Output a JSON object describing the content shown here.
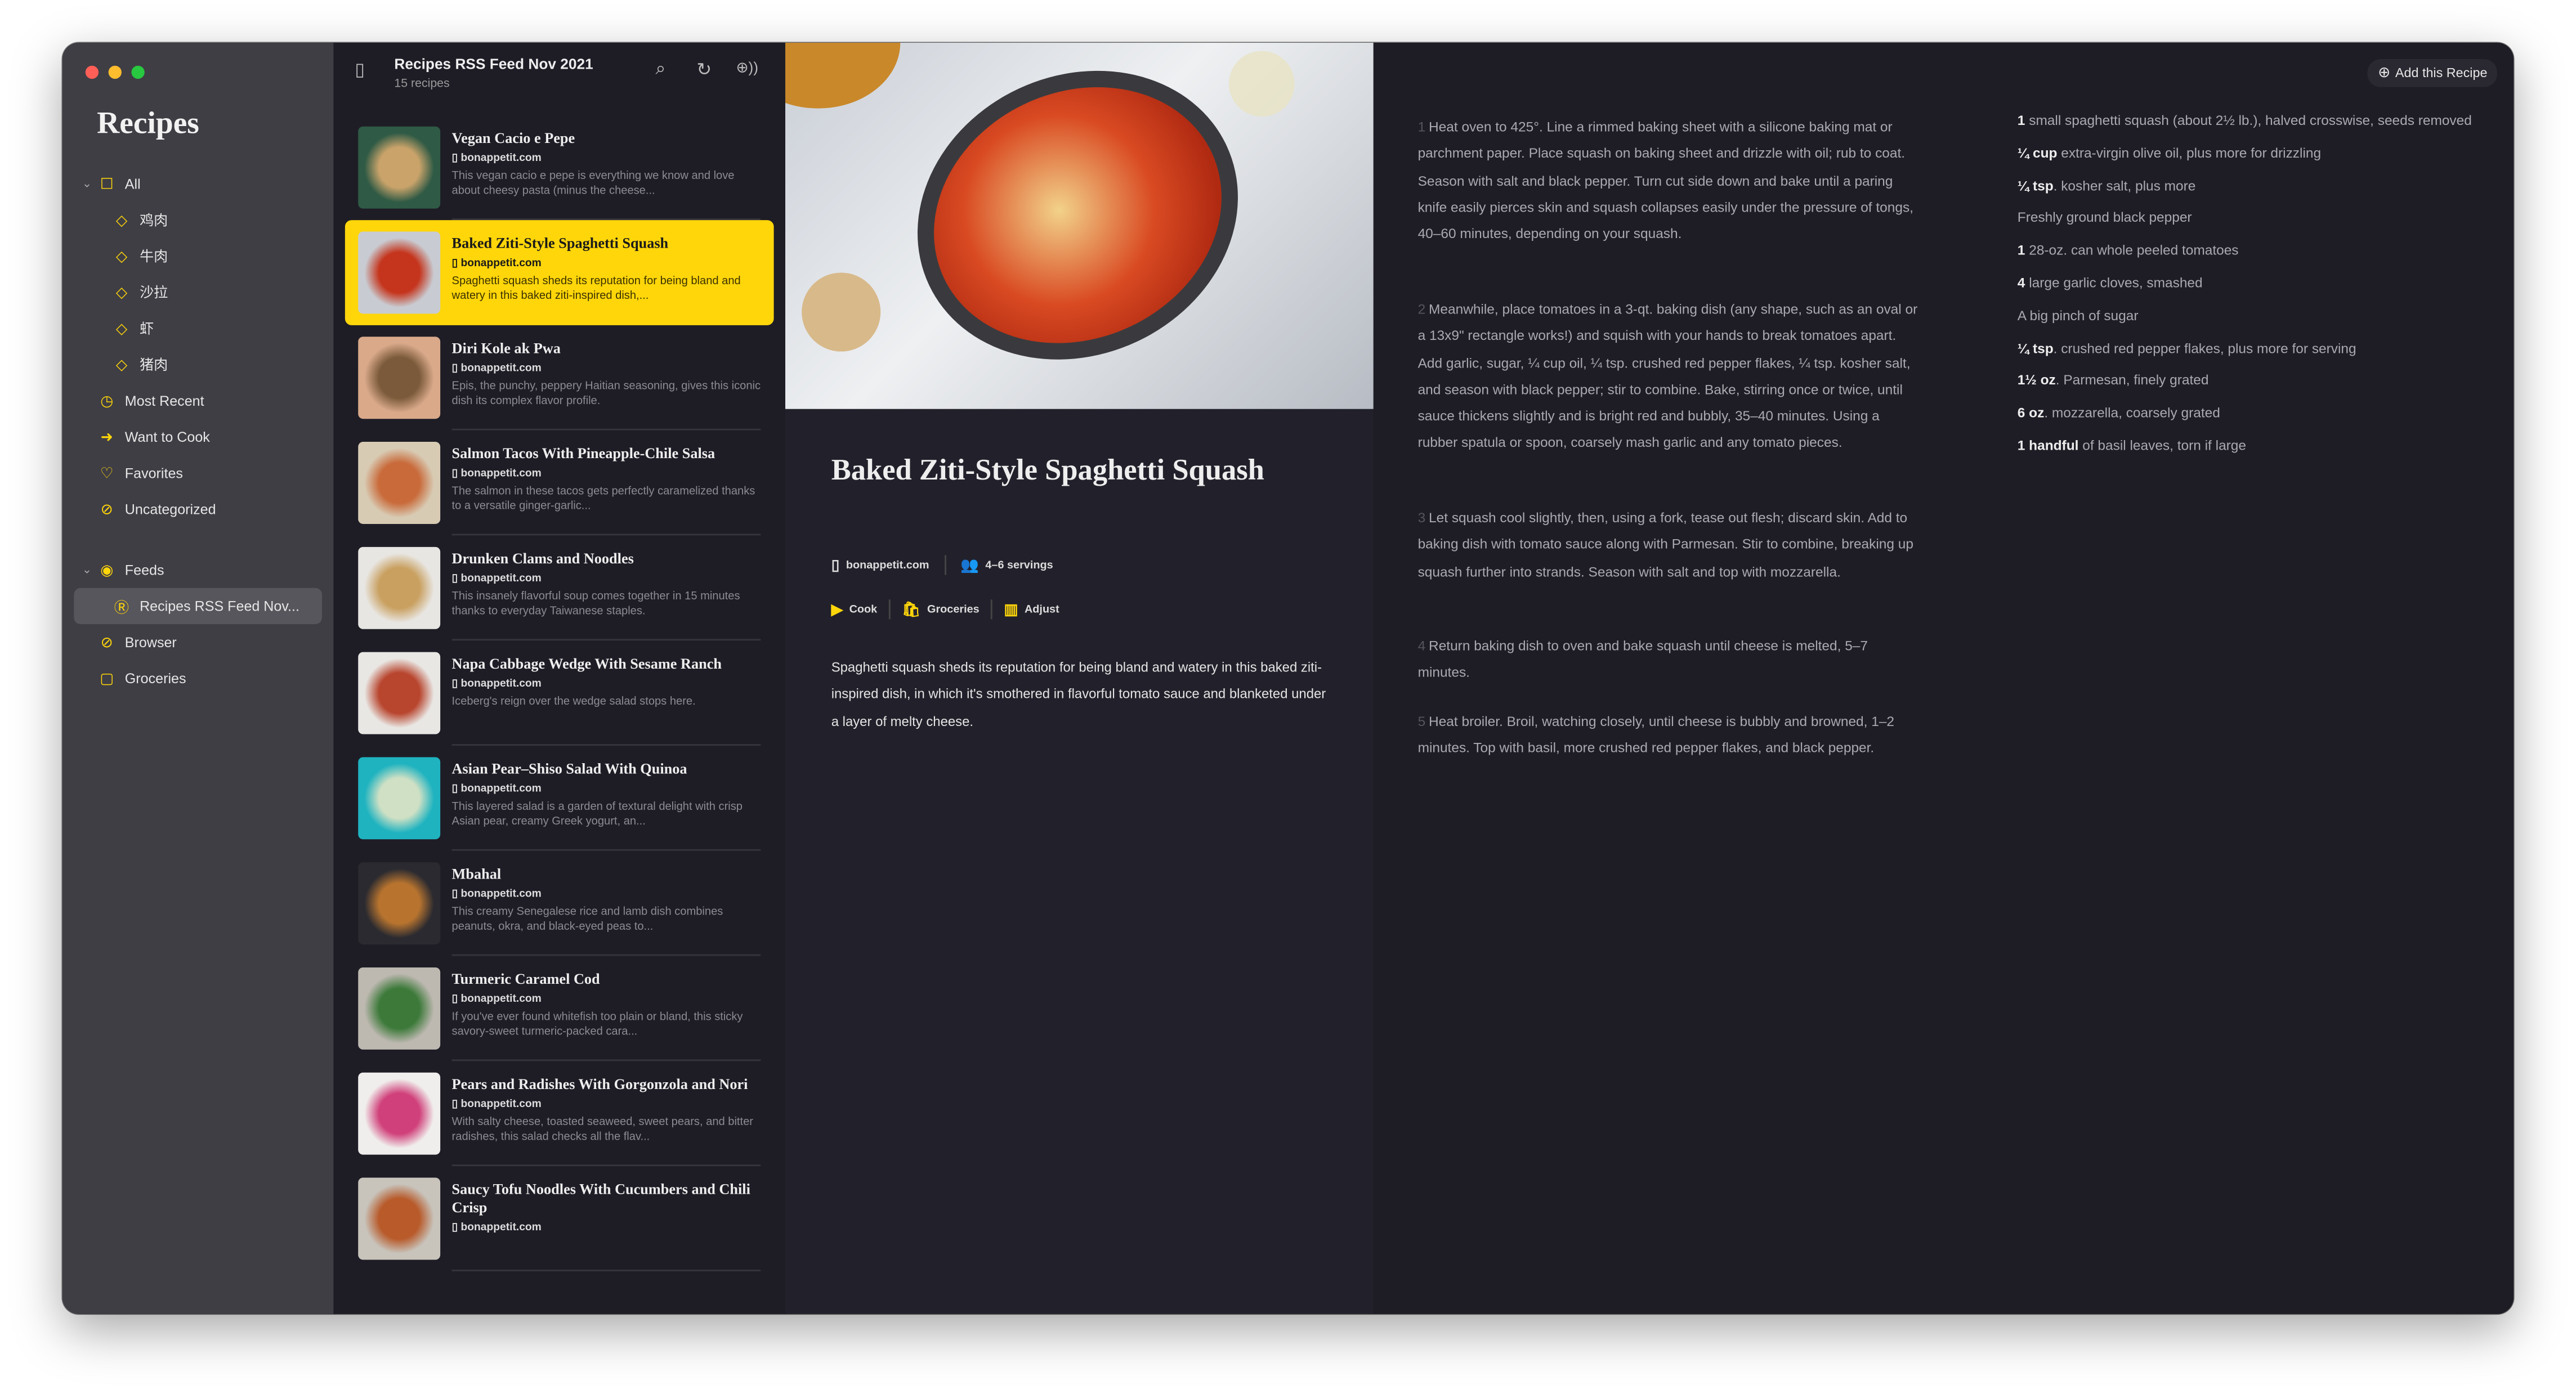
{
  "sidebar": {
    "app_title": "Recipes",
    "items": [
      {
        "label": "All",
        "icon": "tray-icon",
        "level": 0,
        "chevron": true
      },
      {
        "label": "鸡肉",
        "icon": "tag-icon",
        "level": 1
      },
      {
        "label": "牛肉",
        "icon": "tag-icon",
        "level": 1
      },
      {
        "label": "沙拉",
        "icon": "tag-icon",
        "level": 1
      },
      {
        "label": "虾",
        "icon": "tag-icon",
        "level": 1
      },
      {
        "label": "猪肉",
        "icon": "tag-icon",
        "level": 1
      },
      {
        "label": "Most Recent",
        "icon": "clock-icon",
        "level": 0
      },
      {
        "label": "Want to Cook",
        "icon": "arrow-circle-icon",
        "level": 0
      },
      {
        "label": "Favorites",
        "icon": "heart-icon",
        "level": 0
      },
      {
        "label": "Uncategorized",
        "icon": "tag-slash-icon",
        "level": 0
      },
      {
        "label": "Feeds",
        "icon": "feed-icon",
        "level": 0,
        "chevron": true,
        "gap": true
      },
      {
        "label": "Recipes RSS Feed Nov...",
        "icon": "rss-icon",
        "level": 1,
        "selected": true
      },
      {
        "label": "Browser",
        "icon": "compass-icon",
        "level": 0
      },
      {
        "label": "Groceries",
        "icon": "bag-icon",
        "level": 0
      }
    ]
  },
  "list": {
    "title": "Recipes RSS Feed Nov 2021",
    "subtitle": "15 recipes",
    "items": [
      {
        "name": "Vegan Cacio e Pepe",
        "source": "bonappetit.com",
        "desc": "This vegan cacio e pepe is everything we know and love about cheesy pasta (minus the cheese...",
        "colors": [
          "#2f5a45",
          "#c9a36a"
        ]
      },
      {
        "name": "Baked Ziti-Style Spaghetti Squash",
        "source": "bonappetit.com",
        "desc": "Spaghetti squash sheds its reputation for being bland and watery in this baked ziti-inspired dish,...",
        "colors": [
          "#c8ccd2",
          "#c5341c"
        ],
        "selected": true
      },
      {
        "name": "Diri Kole ak Pwa",
        "source": "bonappetit.com",
        "desc": "Epis, the punchy, peppery Haitian seasoning, gives this iconic dish its complex flavor profile.",
        "colors": [
          "#d9a98a",
          "#7a5a3a"
        ]
      },
      {
        "name": "Salmon Tacos With Pineapple-Chile Salsa",
        "source": "bonappetit.com",
        "desc": "The salmon in these tacos gets perfectly caramelized thanks to a versatile ginger-garlic...",
        "colors": [
          "#d8cbb4",
          "#c96a3a"
        ]
      },
      {
        "name": "Drunken Clams and Noodles",
        "source": "bonappetit.com",
        "desc": "This insanely flavorful soup comes together in 15 minutes thanks to everyday Taiwanese staples.",
        "colors": [
          "#e8e6e2",
          "#c9a060"
        ]
      },
      {
        "name": "Napa Cabbage Wedge With Sesame Ranch",
        "source": "bonappetit.com",
        "desc": "Iceberg's reign over the wedge salad stops here.",
        "colors": [
          "#e9e7e4",
          "#b8452e"
        ]
      },
      {
        "name": "Asian Pear–Shiso Salad With Quinoa",
        "source": "bonappetit.com",
        "desc": "This layered salad is a garden of textural delight with crisp Asian pear, creamy Greek yogurt, an...",
        "colors": [
          "#1fb3c0",
          "#cfe0c4"
        ]
      },
      {
        "name": "Mbahal",
        "source": "bonappetit.com",
        "desc": "This creamy Senegalese rice and lamb dish combines peanuts, okra, and black-eyed peas to...",
        "colors": [
          "#2a2a30",
          "#b8742f"
        ]
      },
      {
        "name": "Turmeric Caramel Cod",
        "source": "bonappetit.com",
        "desc": "If you've ever found whitefish too plain or bland, this sticky savory-sweet turmeric-packed cara...",
        "colors": [
          "#bdb8b0",
          "#3d7a3a"
        ]
      },
      {
        "name": "Pears and Radishes With Gorgonzola and Nori",
        "source": "bonappetit.com",
        "desc": "With salty cheese, toasted seaweed, sweet pears, and bitter radishes, this salad checks all the flav...",
        "colors": [
          "#f0eeec",
          "#d0407a"
        ]
      },
      {
        "name": "Saucy Tofu Noodles With Cucumbers and Chili Crisp",
        "source": "bonappetit.com",
        "desc": "",
        "colors": [
          "#c8c4bc",
          "#b85a2a"
        ]
      }
    ]
  },
  "detail": {
    "title": "Baked Ziti-Style Spaghetti Squash",
    "source": "bonappetit.com",
    "servings": "4–6 servings",
    "actions": {
      "cook": "Cook",
      "groceries": "Groceries",
      "adjust": "Adjust"
    },
    "summary": "Spaghetti squash sheds its reputation for being bland and watery in this baked ziti-inspired dish, in which it's smothered in flavorful tomato sauce and blanketed under a layer of melty cheese."
  },
  "steps": [
    {
      "n": "1",
      "text": "Heat oven to 425°. Line a rimmed baking sheet with a silicone baking mat or parchment paper. Place squash on baking sheet and drizzle with oil; rub to coat. Season with salt and black pepper. Turn cut side down and bake until a paring knife easily pierces skin and squash collapses easily under the pressure of tongs, 40–60 minutes, depending on your squash."
    },
    {
      "n": "2",
      "text": "Meanwhile, place tomatoes in a 3-qt. baking dish (any shape, such as an oval or a 13x9\" rectangle works!) and squish with your hands to break tomatoes apart. Add garlic, sugar, ¼ cup oil, ¼ tsp. crushed red pepper flakes, ¼ tsp. kosher salt, and season with black pepper; stir to combine. Bake, stirring once or twice, until sauce thickens slightly and is bright red and bubbly, 35–40 minutes. Using a rubber spatula or spoon, coarsely mash garlic and any tomato pieces."
    },
    {
      "n": "3",
      "text": "Let squash cool slightly, then, using a fork, tease out flesh; discard skin. Add to baking dish with tomato sauce along with Parmesan. Stir to combine, breaking up squash further into strands. Season with salt and top with mozzarella."
    },
    {
      "n": "4",
      "text": "Return baking dish to oven and bake squash until cheese is melted, 5–7 minutes."
    },
    {
      "n": "5",
      "text": "Heat broiler. Broil, watching closely, until cheese is bubbly and browned, 1–2 minutes. Top with basil, more crushed red pepper flakes, and black pepper."
    }
  ],
  "ingredients": {
    "add_button": "Add this Recipe",
    "items": [
      {
        "qty": "1",
        "text": " small spaghetti squash (about 2½ lb.), halved crosswise, seeds removed"
      },
      {
        "qty": "¼ cup",
        "text": " extra-virgin olive oil, plus more for drizzling"
      },
      {
        "qty": "¼ tsp",
        "text": ". kosher salt, plus more"
      },
      {
        "qty": "",
        "text": "Freshly ground black pepper"
      },
      {
        "qty": "1",
        "text": " 28-oz. can whole peeled tomatoes"
      },
      {
        "qty": "4",
        "text": " large garlic cloves, smashed"
      },
      {
        "qty": "",
        "text": "A big pinch of sugar"
      },
      {
        "qty": "¼ tsp",
        "text": ". crushed red pepper flakes, plus more for serving"
      },
      {
        "qty": "1½ oz",
        "text": ". Parmesan, finely grated"
      },
      {
        "qty": "6 oz",
        "text": ". mozzarella, coarsely grated"
      },
      {
        "qty": "1 handful",
        "text": " of basil leaves, torn if large"
      }
    ]
  },
  "colors": {
    "accent": "#ffd60a",
    "sidebar": "#3f3e45",
    "background": "#1e1d26"
  }
}
